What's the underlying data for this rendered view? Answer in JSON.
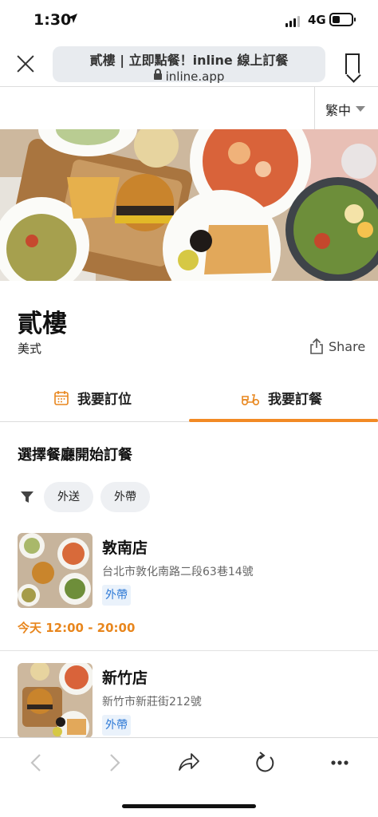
{
  "status_bar": {
    "time": "1:30",
    "network": "4G"
  },
  "browser": {
    "page_title": "貳樓 | 立即點餐！inline 線上訂餐",
    "host": "inline.app"
  },
  "language": {
    "selected": "繁中"
  },
  "restaurant": {
    "name": "貳樓",
    "cuisine": "美式",
    "share_label": "Share"
  },
  "tabs": [
    {
      "label": "我要訂位",
      "icon": "calendar-icon",
      "active": false
    },
    {
      "label": "我要訂餐",
      "icon": "scooter-icon",
      "active": true
    }
  ],
  "section_title": "選擇餐廳開始訂餐",
  "filters": [
    "外送",
    "外帶"
  ],
  "stores": [
    {
      "name": "敦南店",
      "address": "台北市敦化南路二段63巷14號",
      "tag": "外帶",
      "hours": "今天 12:00 - 20:00"
    },
    {
      "name": "新竹店",
      "address": "新竹市新莊街212號",
      "tag": "外帶"
    }
  ],
  "colors": {
    "accent": "#f28a24",
    "tag_blue": "#2f7ad6"
  }
}
